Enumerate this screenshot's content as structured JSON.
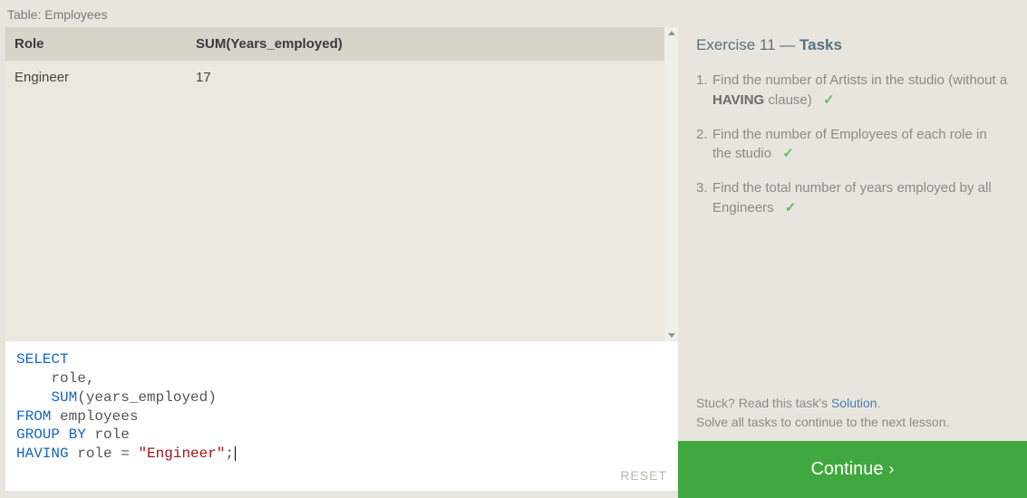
{
  "table": {
    "title": "Table: Employees",
    "headers": {
      "role": "Role",
      "sum": "SUM(Years_employed)"
    },
    "rows": [
      {
        "role": "Engineer",
        "sum": "17"
      }
    ]
  },
  "editor": {
    "kw_select": "SELECT",
    "col1": "role,",
    "fn_sum": "SUM",
    "sum_arg_open": "(years_employed)",
    "kw_from": "FROM",
    "tbl": "employees",
    "kw_group_by": "GROUP BY",
    "gb_col": "role",
    "kw_having": "HAVING",
    "hv_col": "role =",
    "str": "\"Engineer\"",
    "semi": ";",
    "reset": "RESET"
  },
  "exercise": {
    "title_prefix": "Exercise 11 —",
    "title_suffix": "Tasks",
    "tasks": [
      {
        "num": "1.",
        "pre": "Find the number of Artists in the studio (without a ",
        "bold": "HAVING",
        "post": " clause)",
        "done": true
      },
      {
        "num": "2.",
        "pre": "Find the number of Employees of each role in the studio",
        "bold": "",
        "post": "",
        "done": true
      },
      {
        "num": "3.",
        "pre": "Find the total number of years employed by all Engineers",
        "bold": "",
        "post": "",
        "done": true
      }
    ],
    "hint_pre": "Stuck? Read this task's ",
    "hint_link": "Solution",
    "hint_post": ".",
    "hint_line2": "Solve all tasks to continue to the next lesson.",
    "continue": "Continue",
    "check_glyph": "✓",
    "chevron": "›"
  }
}
